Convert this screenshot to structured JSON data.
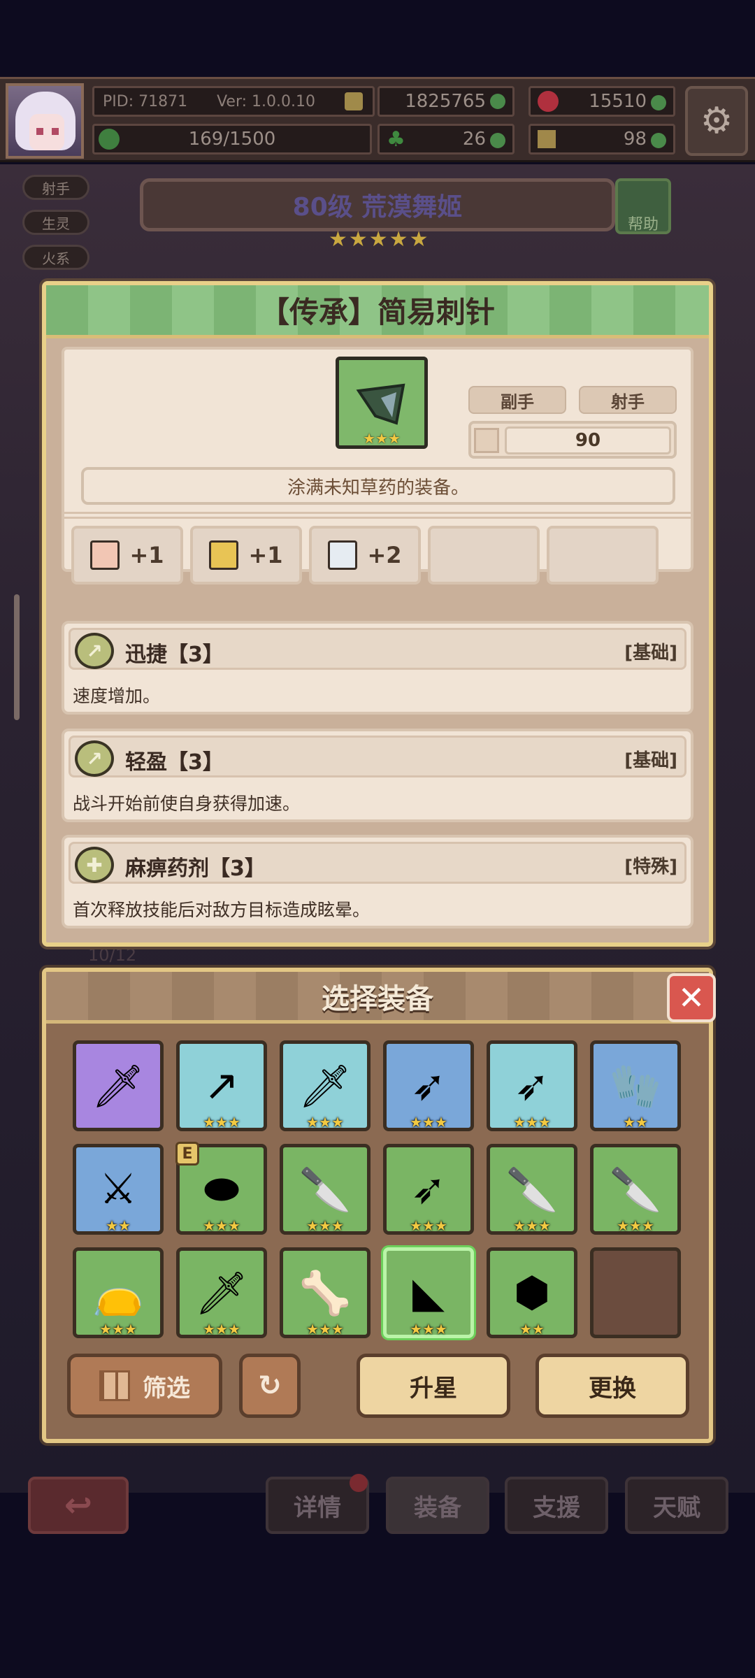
{
  "topbar": {
    "pid": "PID: 71871",
    "version": "Ver: 1.0.0.10",
    "gold": "1825765",
    "gems": "15510",
    "stamina": "169/1500",
    "clover": "26",
    "shoe": "98"
  },
  "hero": {
    "tags": [
      "射手",
      "生灵",
      "火系"
    ],
    "title": "80级 荒漠舞姬",
    "stars": "★★★★★",
    "help": "帮助"
  },
  "detail": {
    "title": "【传承】简易刺针",
    "item_stars": "★★★",
    "slot_type": "副手",
    "class": "射手",
    "power": "90",
    "description": "涂满未知草药的装备。",
    "bonuses": [
      "+1",
      "+1",
      "+2"
    ],
    "skills": [
      {
        "name": "迅捷【3】",
        "type": "[基础]",
        "desc": "速度增加。"
      },
      {
        "name": "轻盈【3】",
        "type": "[基础]",
        "desc": "战斗开始前使自身获得加速。"
      },
      {
        "name": "麻痹药剂【3】",
        "type": "[特殊]",
        "desc": "首次释放技能后对敌方目标造成眩晕。"
      }
    ]
  },
  "background": {
    "counter": "10/12"
  },
  "select": {
    "title": "选择装备",
    "filter": "筛选",
    "upgrade": "升星",
    "replace": "更换",
    "equipped_badge": "E",
    "items": [
      {
        "icon": "sword-icon",
        "stars": ""
      },
      {
        "icon": "spear-icon",
        "stars": "★★★"
      },
      {
        "icon": "dagger-icon",
        "stars": "★★★"
      },
      {
        "icon": "arrow-icon",
        "stars": "★★★"
      },
      {
        "icon": "arrow-icon",
        "stars": "★★★"
      },
      {
        "icon": "glove-icon",
        "stars": "★★"
      },
      {
        "icon": "blade-icon",
        "stars": "★★"
      },
      {
        "icon": "shield-icon",
        "stars": "★★★"
      },
      {
        "icon": "knife-icon",
        "stars": "★★★"
      },
      {
        "icon": "arrow-icon",
        "stars": "★★★"
      },
      {
        "icon": "knife-icon",
        "stars": "★★★"
      },
      {
        "icon": "knife-icon",
        "stars": "★★★"
      },
      {
        "icon": "pouch-icon",
        "stars": "★★★"
      },
      {
        "icon": "dagger-icon",
        "stars": "★★★"
      },
      {
        "icon": "bone-icon",
        "stars": "★★★"
      },
      {
        "icon": "needle-icon",
        "stars": "★★★"
      },
      {
        "icon": "stone-icon",
        "stars": "★★"
      },
      {
        "icon": "empty",
        "stars": ""
      }
    ]
  },
  "nav": {
    "details": "详情",
    "equipment": "装备",
    "support": "支援",
    "talent": "天赋"
  },
  "colors": {
    "green": "#7ab564",
    "blue": "#7aa7d9",
    "cyan": "#8fd1d8",
    "purple": "#a886e0",
    "gold_frame": "#e8d089",
    "star": "#f2c942"
  }
}
